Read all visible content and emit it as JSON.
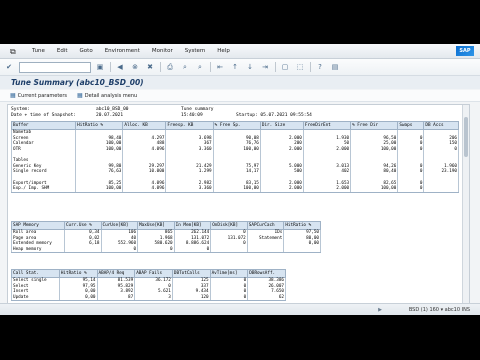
{
  "menubar": {
    "items": [
      "Tune",
      "Edit",
      "Goto",
      "Environment",
      "Monitor",
      "System",
      "Help"
    ]
  },
  "title": "Tune Summary (abc10_BSD_00)",
  "appbar": {
    "current_parameters": "Current parameters",
    "detail_analysis_menu": "Detail analysis menu"
  },
  "info": {
    "rows": [
      [
        "System:",
        "abc10_BSD_00",
        "Tune summary",
        ""
      ],
      [
        "Date + time of Snapshot:",
        "20.07.2021",
        "15:40:09",
        "Startup:   05.07.2021   09:55:54"
      ]
    ]
  },
  "buffer_table": {
    "headers": [
      "Buffer",
      "HitRatio %",
      "Alloc. KB",
      "Freesp. KB",
      "% Free Sp.",
      "Dir. Size",
      "FreeDirEnt",
      "% Free Dir",
      "Swaps",
      "DB Accs"
    ],
    "rows": [
      [
        "Nametab",
        "",
        "",
        "",
        "",
        "",
        "",
        "",
        "",
        ""
      ],
      [
        "Screen",
        "98,40",
        "4.297",
        "3.698",
        "90,08",
        "2.000",
        "1.930",
        "96,50",
        "0",
        "206"
      ],
      [
        "Calendar",
        "100,00",
        "488",
        "367",
        "76,76",
        "200",
        "50",
        "25,00",
        "0",
        "150"
      ],
      [
        "OTR",
        "100,00",
        "4.096",
        "3.360",
        "100,00",
        "2.000",
        "2.000",
        "100,00",
        "0",
        "0"
      ],
      [
        "",
        "",
        "",
        "",
        "",
        "",
        "",
        "",
        "",
        ""
      ],
      [
        "Tables",
        "",
        "",
        "",
        "",
        "",
        "",
        "",
        "",
        ""
      ],
      [
        "  Generic Key",
        "99,80",
        "29.297",
        "21.429",
        "75,97",
        "5.000",
        "3.013",
        "94,26",
        "0",
        "1.960"
      ],
      [
        "  Single record",
        "76,63",
        "10.000",
        "1.299",
        "14,17",
        "500",
        "402",
        "80,40",
        "0",
        "23.190"
      ],
      [
        "",
        "",
        "",
        "",
        "",
        "",
        "",
        "",
        "",
        ""
      ],
      [
        "Export/import",
        "85,25",
        "4.096",
        "2.982",
        "83,15",
        "2.000",
        "1.653",
        "82,65",
        "0",
        ""
      ],
      [
        "Exp./ Imp. SHM",
        "100,00",
        "4.096",
        "3.360",
        "100,00",
        "2.000",
        "2.000",
        "100,00",
        "0",
        ""
      ]
    ]
  },
  "sap_memory_table": {
    "headers": [
      "SAP Memory",
      "Curr.Use %",
      "CurUse[KB]",
      "MaxUse[KB]",
      "In Mem[KB]",
      "OnDisk[KB]",
      "SAPCurCach",
      "HitRatio %"
    ],
    "rows": [
      [
        "Roll area",
        "0,34",
        "106",
        "865",
        "262.144",
        "0",
        "IDs",
        "97,50"
      ],
      [
        "Page area",
        "0,02",
        "40",
        "1.968",
        "131.072",
        "131.072",
        "Statement",
        "80,00"
      ],
      [
        "Extended memory",
        "6,18",
        "552.960",
        "580.620",
        "8.886.624",
        "0",
        "",
        "0,00"
      ],
      [
        "Heap memory",
        "",
        "0",
        "0",
        "0",
        "",
        "",
        ""
      ]
    ]
  },
  "call_stat_table": {
    "headers": [
      "Call Stat.",
      "HitRatio %",
      "ABAP/4 Req",
      "ABAP Fails",
      "DBTotCalls",
      "AvTime[ms]",
      "DBRowsAff."
    ],
    "rows": [
      [
        "Select single",
        "95,14",
        "81.539",
        "36.172",
        "125",
        "0",
        "38.386"
      ],
      [
        "Select",
        "97,95",
        "95.829",
        "0",
        "337",
        "0",
        "26.007"
      ],
      [
        "Insert",
        "0,00",
        "3.892",
        "5.621",
        "9.434",
        "0",
        "7.650"
      ],
      [
        "Update",
        "0,00",
        "87",
        "3",
        "120",
        "0",
        "62"
      ]
    ]
  },
  "status": {
    "text": "BSD (1) 160 ▾  abc10  INS",
    "triangle": "▶"
  }
}
